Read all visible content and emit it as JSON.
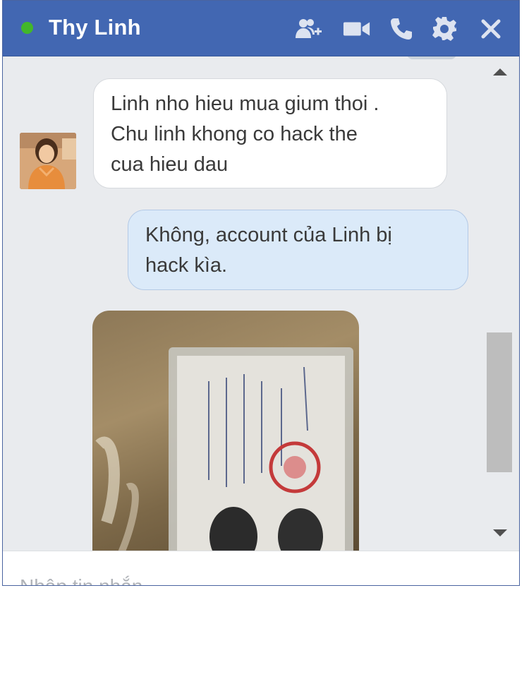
{
  "chat": {
    "contact_name": "Thy Linh",
    "status": "online",
    "accent_color": "#4267b2",
    "online_color": "#42b72a"
  },
  "header_icons": [
    "add-friend-icon",
    "video-call-icon",
    "phone-icon",
    "gear-icon",
    "close-icon"
  ],
  "messages": [
    {
      "direction": "incoming",
      "lines": [
        "Linh nho hieu mua gium thoi .",
        "Chu linh khong co hack the",
        "cua hieu dau"
      ]
    },
    {
      "direction": "outgoing",
      "lines": [
        "Không, account của Linh bị",
        "hack kìa."
      ]
    },
    {
      "direction": "incoming",
      "type": "photo"
    }
  ],
  "composer": {
    "placeholder": "Nhập tin nhắn..."
  }
}
